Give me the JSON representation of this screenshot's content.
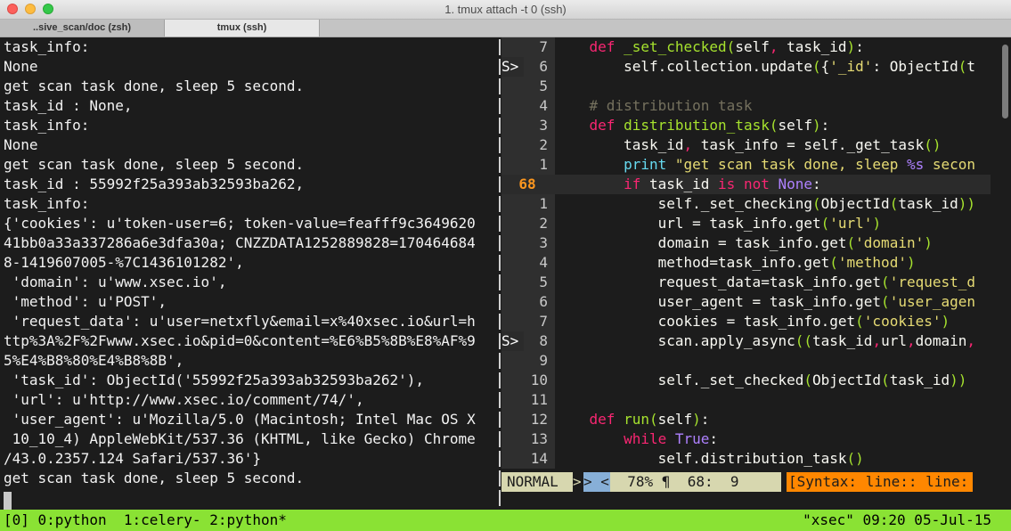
{
  "window": {
    "title": "1. tmux attach -t 0 (ssh)",
    "tabs": [
      "..sive_scan/doc (zsh)",
      "tmux (ssh)"
    ]
  },
  "left_pane": {
    "lines": [
      "task_info:",
      "None",
      "get scan task done, sleep 5 second.",
      "task_id : None,",
      "task_info:",
      "None",
      "get scan task done, sleep 5 second.",
      "task_id : 55992f25a393ab32593ba262,",
      "task_info:",
      "{'cookies': u'token-user=6; token-value=feafff9c3649620",
      "41bb0a33a337286a6e3dfa30a; CNZZDATA1252889828=170464684",
      "8-1419607005-%7C1436101282',",
      " 'domain': u'www.xsec.io',",
      " 'method': u'POST',",
      " 'request_data': u'user=netxfly&email=x%40xsec.io&url=h",
      "ttp%3A%2F%2Fwww.xsec.io&pid=0&content=%E6%B5%8B%E8%AF%9",
      "5%E4%B8%80%E4%B8%8B',",
      " 'task_id': ObjectId('55992f25a393ab32593ba262'),",
      " 'url': u'http://www.xsec.io/comment/74/',",
      " 'user_agent': u'Mozilla/5.0 (Macintosh; Intel Mac OS X",
      " 10_10_4) AppleWebKit/537.36 (KHTML, like Gecko) Chrome",
      "/43.0.2357.124 Safari/537.36'}",
      "get scan task done, sleep 5 second."
    ]
  },
  "editor": {
    "sign": "S>",
    "line_numbers": [
      "7",
      "6",
      "5",
      "4",
      "3",
      "2",
      "1",
      "68",
      "1",
      "2",
      "3",
      "4",
      "5",
      "6",
      "7",
      "8",
      "9",
      "10",
      "11",
      "12",
      "13",
      "14"
    ],
    "code_lines": [
      "    def _set_checked(self, task_id):",
      "        self.collection.update({'_id': ObjectId(t",
      "",
      "    # distribution task",
      "    def distribution_task(self):",
      "        task_id, task_info = self._get_task()",
      "        print \"get scan task done, sleep %s secon",
      "        if task_id is not None:",
      "            self._set_checking(ObjectId(task_id))",
      "            url = task_info.get('url')",
      "            domain = task_info.get('domain')",
      "            method=task_info.get('method')",
      "            request_data=task_info.get('request_d",
      "            user_agent = task_info.get('user_agen",
      "            cookies = task_info.get('cookies')",
      "            scan.apply_async((task_id,url,domain,",
      "",
      "            self._set_checked(ObjectId(task_id))",
      "",
      "    def run(self):",
      "        while True:",
      "            self.distribution_task()"
    ],
    "status": {
      "mode": "NORMAL",
      "arrow1": ">",
      "arrow2": "> <",
      "position": "  78% ¶  68:  9",
      "syntax": "[Syntax: line:: line:"
    }
  },
  "tmux": {
    "left": "[0] 0:python  1:celery- 2:python*",
    "right": "\"xsec\" 09:20 05-Jul-15"
  },
  "colors": {
    "keyword": "#f92672",
    "function": "#a6e22e",
    "string": "#e6db74",
    "comment": "#75715e",
    "builtin": "#66d9ef",
    "constant": "#ae81ff",
    "tmux_bar": "#8ae234",
    "mode_bg": "#d7d7af",
    "syntax_bg": "#ff8700"
  }
}
